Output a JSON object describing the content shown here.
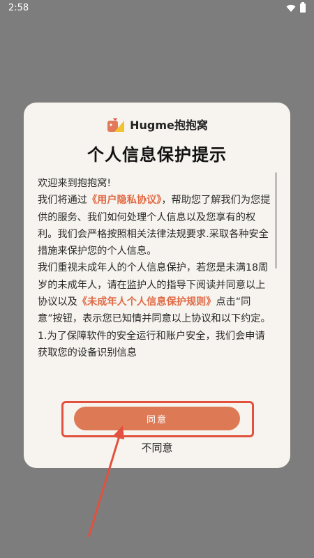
{
  "status_bar": {
    "time": "2:58"
  },
  "dialog": {
    "brand": "Hugme抱抱窝",
    "title": "个人信息保护提示",
    "paragraphs": [
      {
        "parts": [
          {
            "text": "欢迎来到抱抱窝!"
          }
        ]
      },
      {
        "parts": [
          {
            "text": "我们将通过"
          },
          {
            "text": "《用户隐私协议》",
            "link": true
          },
          {
            "text": "，帮助您了解我们为您提供的服务、我们如何处理个人信息以及您享有的权利。我们会严格按照相关法律法规要求.采取各种安全措施来保护您的个人信息。"
          }
        ]
      },
      {
        "parts": [
          {
            "text": "我们重视未成年人的个人信息保护，若您是未满18周岁的未成年人，请在监护人的指导下阅读并同意以上协议以及"
          },
          {
            "text": "《未成年人个人信息保护规则》",
            "link": true
          },
          {
            "text": "点击“同意”按钮，表示您已知情并同意以上协议和以下约定。"
          }
        ]
      },
      {
        "parts": [
          {
            "text": "1.为了保障软件的安全运行和账户安全，我们会申请获取您的设备识别信息"
          }
        ]
      }
    ],
    "agree_label": "同意",
    "disagree_label": "不同意"
  },
  "colors": {
    "link": "#e06a45",
    "agree_button": "#dd7a55",
    "annotation": "#e2503e"
  }
}
